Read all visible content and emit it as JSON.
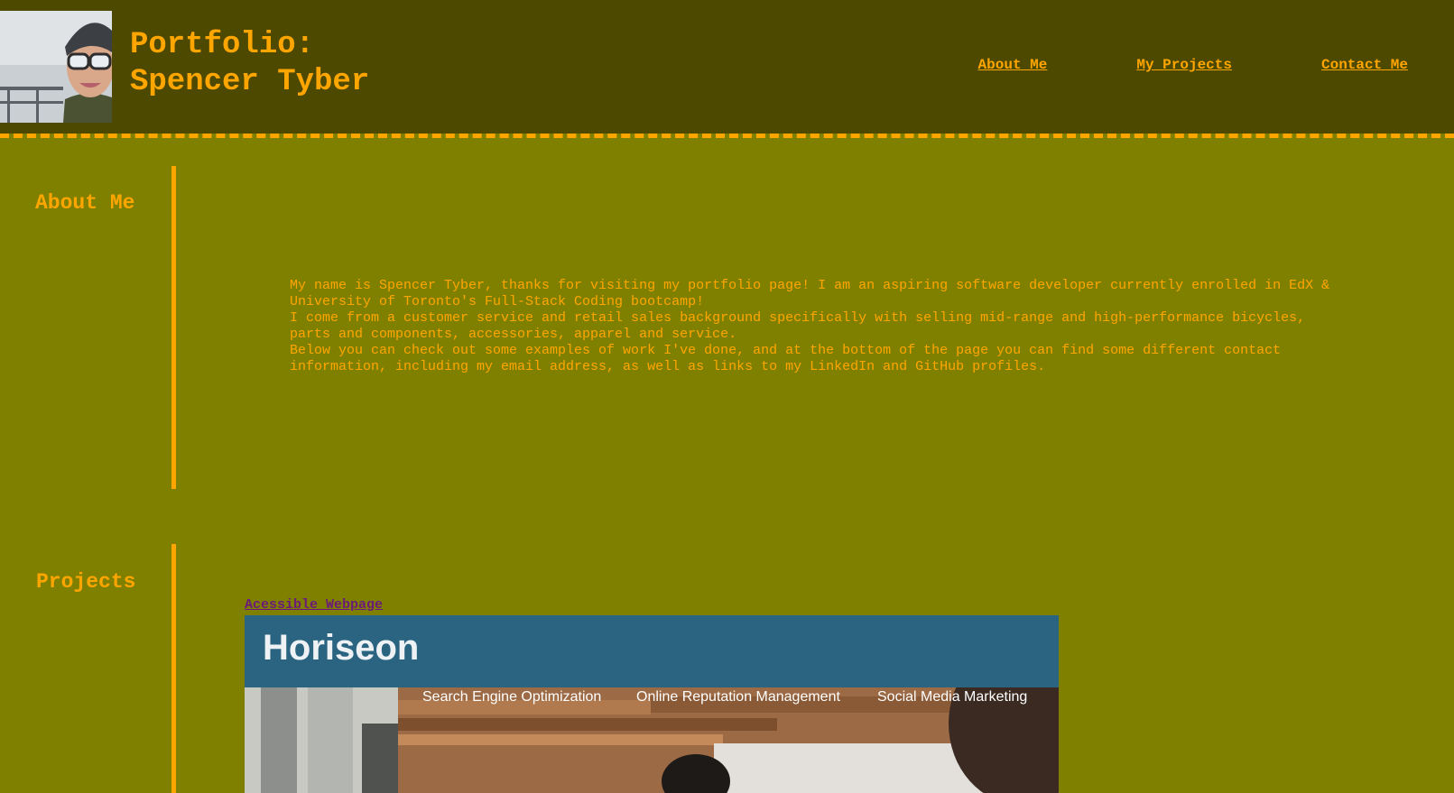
{
  "header": {
    "title_line1": "Portfolio:",
    "title_line2": "Spencer Tyber",
    "avatar_alt": "Photo of Spencer Tyber",
    "nav": [
      {
        "label": "About Me"
      },
      {
        "label": "My Projects"
      },
      {
        "label": "Contact Me"
      }
    ]
  },
  "about": {
    "heading": "About Me",
    "paragraphs": [
      "My name is Spencer Tyber, thanks for visiting my portfolio page! I am an aspiring software developer currently enrolled in EdX & University of Toronto's Full-Stack Coding bootcamp!",
      "I come from a customer service and retail sales background specifically with selling mid-range and high-performance bicycles, parts and components, accessories, apparel and service.",
      "Below you can check out some examples of work I've done, and at the bottom of the page you can find some different contact information, including my email address, as well as links to my LinkedIn and GitHub profiles."
    ]
  },
  "projects": {
    "heading": "Projects",
    "items": [
      {
        "link_label": "Acessible Webpage",
        "screenshot": {
          "brand": "Horiseon",
          "nav": [
            "Search Engine Optimization",
            "Online Reputation Management",
            "Social Media Marketing"
          ]
        }
      }
    ]
  },
  "colors": {
    "page_bg": "#808000",
    "header_bg": "#4d4900",
    "accent": "#ffa500",
    "visited_link": "#6b1a7a",
    "screenshot_header": "#2a6481"
  }
}
